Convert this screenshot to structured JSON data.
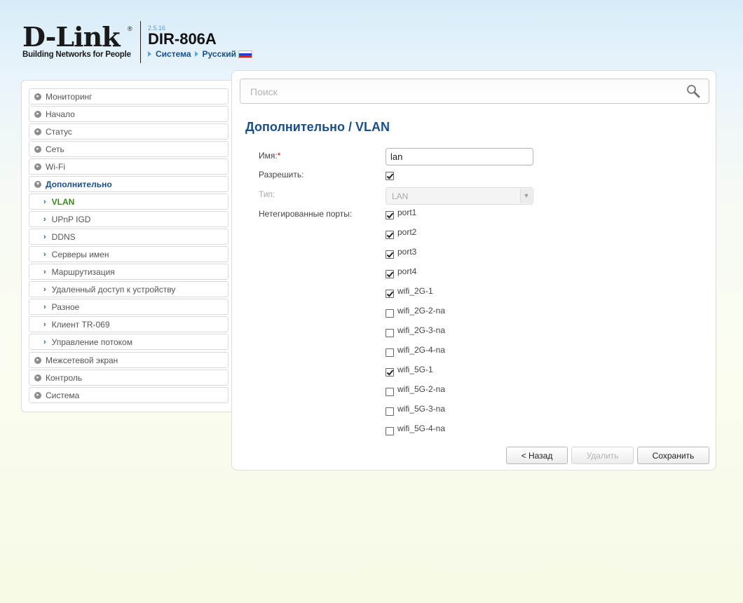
{
  "header": {
    "logo_text": "D-Link",
    "logo_registered": "®",
    "tagline": "Building Networks for People",
    "firmware": "2.5.16",
    "model": "DIR-806A",
    "system_link": "Система",
    "language_link": "Русский",
    "flag_icon": "russia-flag-icon"
  },
  "sidebar": {
    "items": [
      {
        "label": "Мониторинг"
      },
      {
        "label": "Начало"
      },
      {
        "label": "Статус"
      },
      {
        "label": "Сеть"
      },
      {
        "label": "Wi-Fi"
      },
      {
        "label": "Дополнительно"
      },
      {
        "label": "VLAN"
      },
      {
        "label": "UPnP IGD"
      },
      {
        "label": "DDNS"
      },
      {
        "label": "Серверы имен"
      },
      {
        "label": "Маршрутизация"
      },
      {
        "label": "Удаленный доступ к устройству"
      },
      {
        "label": "Разное"
      },
      {
        "label": "Клиент TR-069"
      },
      {
        "label": "Управление потоком"
      },
      {
        "label": "Межсетевой экран"
      },
      {
        "label": "Контроль"
      },
      {
        "label": "Система"
      }
    ]
  },
  "search": {
    "placeholder": "Поиск",
    "value": ""
  },
  "page": {
    "title": "Дополнительно /  VLAN",
    "name_label": "Имя:",
    "required_mark": "*",
    "name_value": "lan",
    "enable_label": "Разрешить:",
    "enable_checked": true,
    "type_label": "Тип:",
    "type_value": "LAN",
    "untagged_label": "Нетегированные порты:",
    "ports": [
      {
        "name": "port1",
        "checked": true
      },
      {
        "name": "port2",
        "checked": true
      },
      {
        "name": "port3",
        "checked": true
      },
      {
        "name": "port4",
        "checked": true
      },
      {
        "name": "wifi_2G-1",
        "checked": true
      },
      {
        "name": "wifi_2G-2-na",
        "checked": false
      },
      {
        "name": "wifi_2G-3-na",
        "checked": false
      },
      {
        "name": "wifi_2G-4-na",
        "checked": false
      },
      {
        "name": "wifi_5G-1",
        "checked": true
      },
      {
        "name": "wifi_5G-2-na",
        "checked": false
      },
      {
        "name": "wifi_5G-3-na",
        "checked": false
      },
      {
        "name": "wifi_5G-4-na",
        "checked": false
      }
    ]
  },
  "buttons": {
    "back": "< Назад",
    "delete": "Удалить",
    "save": "Сохранить"
  },
  "colors": {
    "accent": "#1a4f8a",
    "active_nav": "#3f8a1f",
    "required": "#dd0000"
  }
}
